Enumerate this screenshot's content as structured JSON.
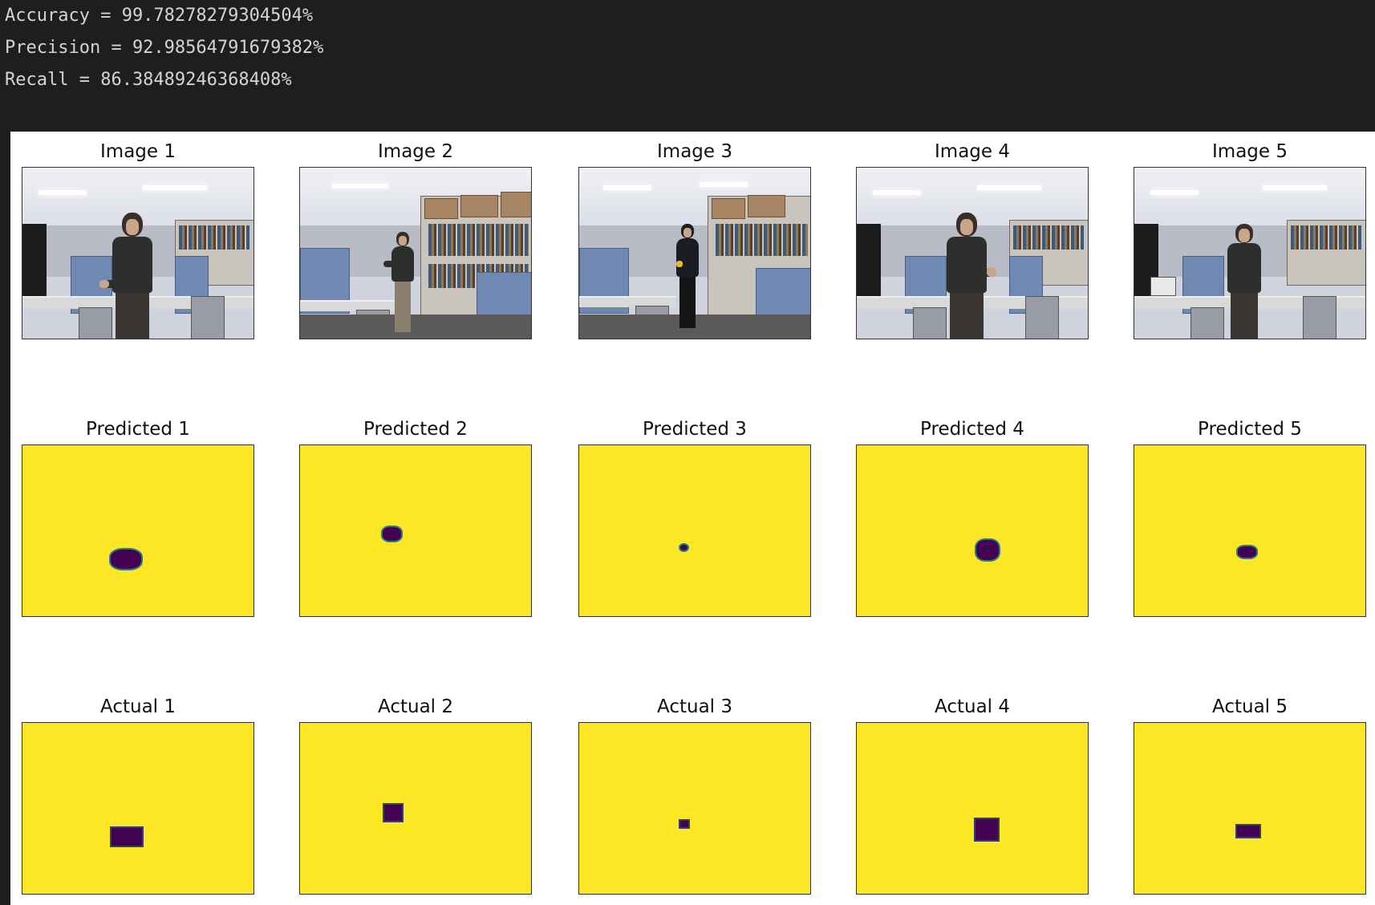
{
  "metrics": {
    "accuracy": "Accuracy = 99.78278279304504%",
    "precision": "Precision = 92.98564791679382%",
    "recall": "Recall = 86.38489246368408%"
  },
  "figure": {
    "image_titles": [
      "Image 1",
      "Image 2",
      "Image 3",
      "Image 4",
      "Image 5"
    ],
    "predicted_titles": [
      "Predicted 1",
      "Predicted 2",
      "Predicted 3",
      "Predicted 4",
      "Predicted 5"
    ],
    "actual_titles": [
      "Actual 1",
      "Actual 2",
      "Actual 3",
      "Actual 4",
      "Actual 5"
    ],
    "colors": {
      "mask_background": "#fde725",
      "mask_foreground": "#440154",
      "console_background": "#1e1e1e",
      "console_text": "#d4d4d4"
    }
  }
}
